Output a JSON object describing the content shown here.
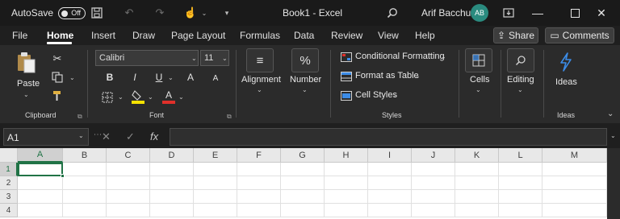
{
  "titlebar": {
    "autosave_label": "AutoSave",
    "autosave_state": "Off",
    "document_title": "Book1 - Excel",
    "user_name": "Arif Bacchus",
    "user_initials": "AB"
  },
  "tabs": [
    "File",
    "Home",
    "Insert",
    "Draw",
    "Page Layout",
    "Formulas",
    "Data",
    "Review",
    "View",
    "Help"
  ],
  "active_tab": "Home",
  "share_label": "Share",
  "comments_label": "Comments",
  "ribbon": {
    "clipboard": {
      "paste_label": "Paste",
      "group_label": "Clipboard"
    },
    "font": {
      "font_name": "Calibri",
      "font_size": "11",
      "bold": "B",
      "italic": "I",
      "underline": "U",
      "grow": "A",
      "shrink": "A",
      "font_color_letter": "A",
      "group_label": "Font"
    },
    "alignment_label": "Alignment",
    "number_label": "Number",
    "number_symbol": "%",
    "styles": {
      "conditional_formatting": "Conditional Formatting",
      "format_as_table": "Format as Table",
      "cell_styles": "Cell Styles",
      "group_label": "Styles"
    },
    "cells_label": "Cells",
    "editing_label": "Editing",
    "ideas_label": "Ideas",
    "ideas_group_label": "Ideas"
  },
  "formula_bar": {
    "name_box": "A1",
    "cancel_symbol": "✕",
    "enter_symbol": "✓",
    "fx_symbol": "fx",
    "formula_value": ""
  },
  "grid": {
    "columns": [
      "A",
      "B",
      "C",
      "D",
      "E",
      "F",
      "G",
      "H",
      "I",
      "J",
      "K",
      "L",
      "M"
    ],
    "rows": [
      "1",
      "2",
      "3",
      "4"
    ],
    "selected_cell": "A1"
  },
  "colors": {
    "excel_green": "#217346",
    "avatar": "#2a8b7f",
    "highlight_yellow": "#f5e100",
    "font_red": "#e0302a",
    "ideas_blue": "#3c8ce7"
  }
}
